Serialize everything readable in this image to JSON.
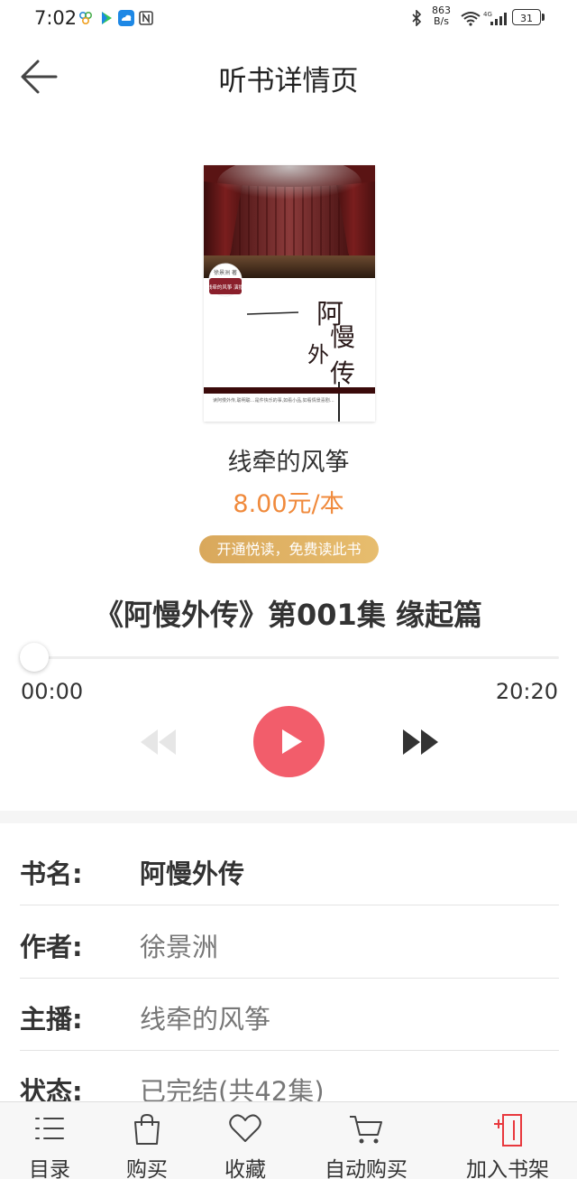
{
  "status_bar": {
    "time": "7:02",
    "net_speed_value": "863",
    "net_speed_unit": "B/s",
    "signal_label": "4G",
    "battery": "31"
  },
  "header": {
    "title": "听书详情页"
  },
  "book": {
    "cover_author_tag": "徐景洲 著",
    "cover_narrator_tag": "线牵的风筝 演播",
    "cover_title_chars": [
      "阿",
      "慢",
      "外",
      "传"
    ],
    "cover_tagline": "读阿慢外传,聪明聪…是件快乐的事,如看小品,如看情景喜剧…",
    "narrator": "线牵的风筝",
    "price": "8.00元/本",
    "vip_button": "开通悦读，免费读此书"
  },
  "player": {
    "episode_title": "《阿慢外传》第001集 缘起篇",
    "current_time": "00:00",
    "total_time": "20:20",
    "progress": 0
  },
  "info": {
    "rows": [
      {
        "label": "书名:",
        "value": "阿慢外传"
      },
      {
        "label": "作者:",
        "value": "徐景洲"
      },
      {
        "label": "主播:",
        "value": "线牵的风筝"
      },
      {
        "label": "状态:",
        "value": "已完结(共42集)"
      }
    ]
  },
  "tabbar": {
    "items": [
      {
        "label": "目录",
        "icon": "list-icon"
      },
      {
        "label": "购买",
        "icon": "shopping-bag-icon"
      },
      {
        "label": "收藏",
        "icon": "heart-icon"
      },
      {
        "label": "自动购买",
        "icon": "cart-icon"
      },
      {
        "label": "加入书架",
        "icon": "add-to-shelf-icon"
      }
    ]
  },
  "colors": {
    "accent": "#f25d6b",
    "price": "#f08a3c",
    "vip_gold": "#dfb266",
    "shelf_icon": "#e8383d"
  }
}
